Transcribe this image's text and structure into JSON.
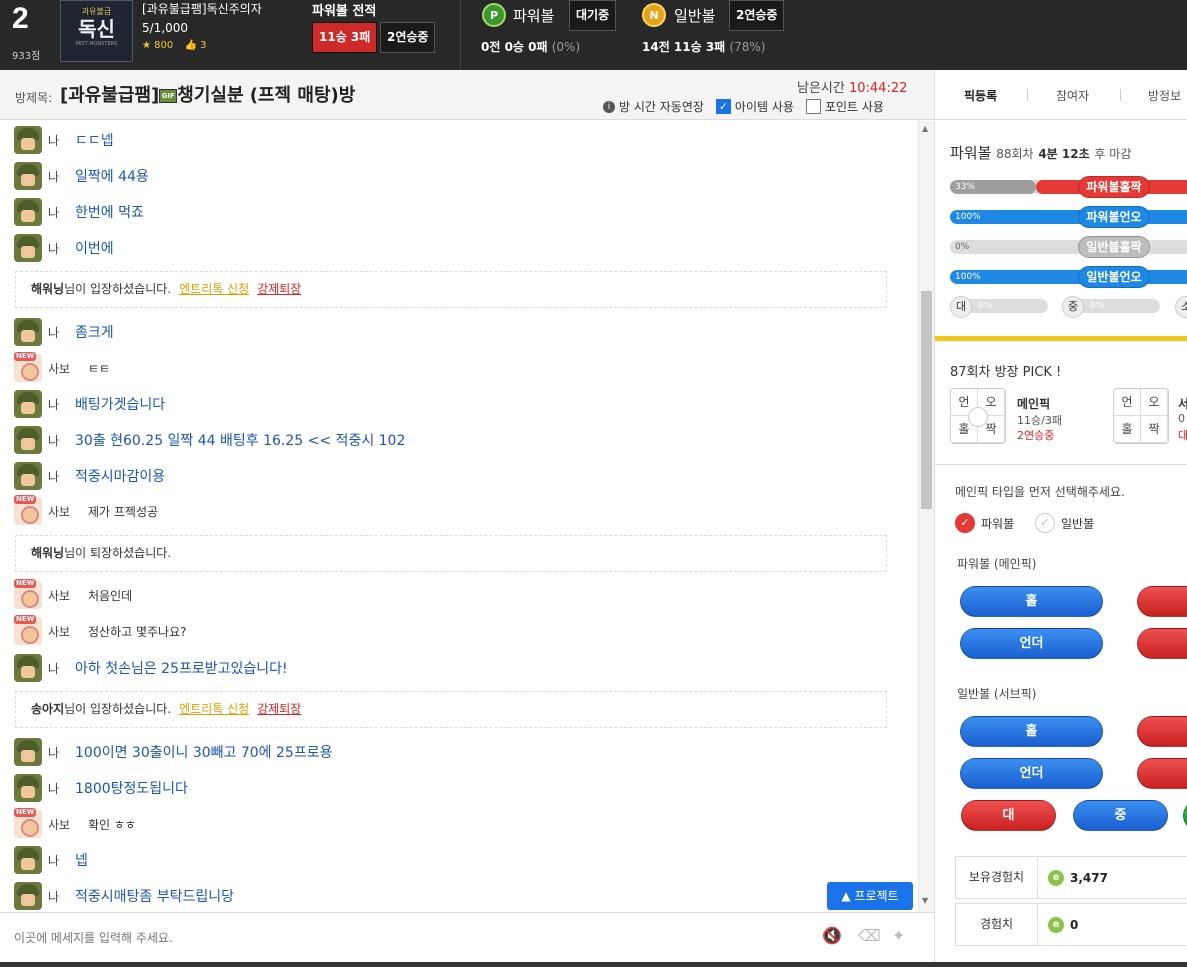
{
  "header": {
    "rank": "2",
    "points": "933점",
    "logo": {
      "line1": "과유불급",
      "line2": "독신",
      "line3": "MIST MONSTERS"
    },
    "room_title": "[과유불급팸]독신주의자",
    "member_count": "5/1,000",
    "star_count": "800",
    "like_count": "3",
    "record_title": "파워볼 전적",
    "record_badge": "11승 3패",
    "streak_badge": "2연승중",
    "powerball": {
      "coin": "P",
      "title": "파워볼",
      "status": "대기중",
      "stats": "0전 0승 0패",
      "pct": "(0%)"
    },
    "normalball": {
      "coin": "N",
      "title": "일반볼",
      "status": "2연승중",
      "stats": "14전 11승 3패",
      "pct": "(78%)"
    }
  },
  "titlebar": {
    "label": "방제목:",
    "room_name_a": "[과유불급팸]",
    "emoji": "GIF",
    "room_name_b": "챙기실분 (프젝 매탕)방",
    "timer_label": "남은시간",
    "timer_value": "10:44:22",
    "auto_extend": "방 시간 자동연장",
    "use_item": "아이템 사용",
    "use_point": "포인트 사용"
  },
  "right_tabs": [
    "픽등록",
    "참여자",
    "방정보"
  ],
  "chat": [
    {
      "type": "me",
      "nick": "나",
      "text": "ㄷㄷ넵"
    },
    {
      "type": "me",
      "nick": "나",
      "text": "일짝에 44용"
    },
    {
      "type": "me",
      "nick": "나",
      "text": "한번에 먹죠"
    },
    {
      "type": "me",
      "nick": "나",
      "text": "이번에"
    },
    {
      "type": "sys",
      "name": "해워닝",
      "text": "님이 입장하셨습니다.",
      "link1": "엔트리톡 신청",
      "link2": "강제퇴장"
    },
    {
      "type": "me",
      "nick": "나",
      "text": "좀크게"
    },
    {
      "type": "other",
      "nick": "사보",
      "text": "ㅌㅌ"
    },
    {
      "type": "me",
      "nick": "나",
      "text": "배팅가겟습니다"
    },
    {
      "type": "me",
      "nick": "나",
      "text": "30출 현60.25 일짝 44 배팅후 16.25 << 적중시 102"
    },
    {
      "type": "me",
      "nick": "나",
      "text": "적중시마감이용"
    },
    {
      "type": "other",
      "nick": "사보",
      "text": "제가 프젝성공"
    },
    {
      "type": "sys",
      "name": "해워닝",
      "text": "님이 퇴장하셨습니다.",
      "link1": "",
      "link2": ""
    },
    {
      "type": "other",
      "nick": "사보",
      "text": "처음인데"
    },
    {
      "type": "other",
      "nick": "사보",
      "text": "정산하고 몇주나요?"
    },
    {
      "type": "me",
      "nick": "나",
      "text": "아하 첫손님은 25프로받고있습니다!"
    },
    {
      "type": "sys",
      "name": "송아지",
      "text": "님이 입장하셨습니다.",
      "link1": "엔트리톡 신청",
      "link2": "강제퇴장"
    },
    {
      "type": "me",
      "nick": "나",
      "text": "100이면 30출이니 30빼고 70에 25프로용"
    },
    {
      "type": "me",
      "nick": "나",
      "text": "1800탕정도됩니다"
    },
    {
      "type": "other",
      "nick": "사보",
      "text": "확인 ㅎㅎ"
    },
    {
      "type": "me",
      "nick": "나",
      "text": "넵"
    },
    {
      "type": "me",
      "nick": "나",
      "text": "적중시매탕좀 부탁드립니당"
    }
  ],
  "protect_button": "▲ 프로젝트",
  "input_placeholder": "이곳에 메세지를 입력해 주세요.",
  "panel": {
    "title": "파워볼",
    "round": "88회차",
    "deadline": "4분 12초",
    "deadline_suffix": "후 마감",
    "bars": [
      {
        "pct": "33%",
        "fill": 0.33,
        "label": "파워볼홀짝",
        "color": "#e53935"
      },
      {
        "pct": "100%",
        "fill": 1.0,
        "label": "파워볼언오",
        "color": "#1e88e5"
      },
      {
        "pct": "0%",
        "fill": 0.0,
        "label": "일반볼홀짝",
        "color": "#bdbdbd"
      },
      {
        "pct": "100%",
        "fill": 1.0,
        "label": "일반볼언오",
        "color": "#1e88e5"
      }
    ],
    "small": [
      {
        "k": "대",
        "pct": "0%"
      },
      {
        "k": "중",
        "pct": "0%"
      },
      {
        "k": "소",
        "pct": ""
      }
    ],
    "pick_title": "87회차 방장 PICK !",
    "main_pick": {
      "cells": [
        "언",
        "오",
        "홀",
        "짝"
      ],
      "name": "메인픽",
      "score": "11승/3패",
      "streak": "2연승중"
    },
    "sub_pick": {
      "cells": [
        "언",
        "오",
        "홀",
        "짝"
      ],
      "name": "서",
      "score": "0",
      "streak": "대"
    },
    "instruction": "메인픽 타입을 먼저 선택해주세요.",
    "radio1": "파워볼",
    "radio2": "일반볼",
    "main_section": "파워볼 (메인픽)",
    "sub_section": "일반볼 (서브픽)",
    "btn_hol": "홀",
    "btn_under": "언더",
    "btn_hol2": "홀",
    "btn_under2": "언더",
    "btn_dae": "대",
    "btn_jung": "중",
    "xp_label": "보유경험치",
    "xp_value": "3,477",
    "exp_label": "경험치",
    "exp_value": "0"
  }
}
